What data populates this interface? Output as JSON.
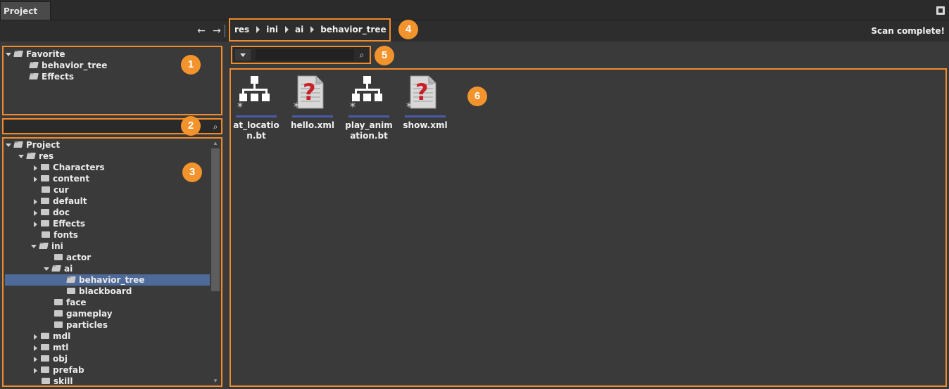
{
  "window": {
    "tab_title": "Project"
  },
  "nav": {
    "back_icon": "arrow-left-icon",
    "forward_icon": "arrow-right-icon",
    "breadcrumb": [
      "res",
      "ini",
      "ai",
      "behavior_tree"
    ],
    "status": "Scan complete!"
  },
  "favorites": {
    "root": "Favorite",
    "items": [
      "behavior_tree",
      "Effects"
    ]
  },
  "tree_search": {
    "value": "",
    "placeholder": ""
  },
  "tree": {
    "root": "Project",
    "res": "res",
    "res_children": [
      "Characters",
      "content",
      "cur",
      "default",
      "doc",
      "Effects",
      "fonts",
      "ini"
    ],
    "ini_children": [
      "actor",
      "ai"
    ],
    "ai_children": [
      "behavior_tree",
      "blackboard"
    ],
    "ini_after": [
      "face",
      "gameplay",
      "particles"
    ],
    "res_after": [
      "mdl",
      "mtl",
      "obj",
      "prefab",
      "skill"
    ],
    "selected": "behavior_tree"
  },
  "filter": {
    "value": "",
    "placeholder": ""
  },
  "files": [
    {
      "name": "at_location.bt",
      "icon": "behavior-tree-icon"
    },
    {
      "name": "hello.xml",
      "icon": "unknown-file-icon"
    },
    {
      "name": "play_animation.bt",
      "icon": "behavior-tree-icon"
    },
    {
      "name": "show.xml",
      "icon": "unknown-file-icon"
    }
  ],
  "annotations": [
    "1",
    "2",
    "3",
    "4",
    "5",
    "6"
  ],
  "colors": {
    "accent": "#f08c2c",
    "selection": "#4e6a99",
    "file_bar": "#4a5aa6",
    "badge": "#f3932c"
  }
}
